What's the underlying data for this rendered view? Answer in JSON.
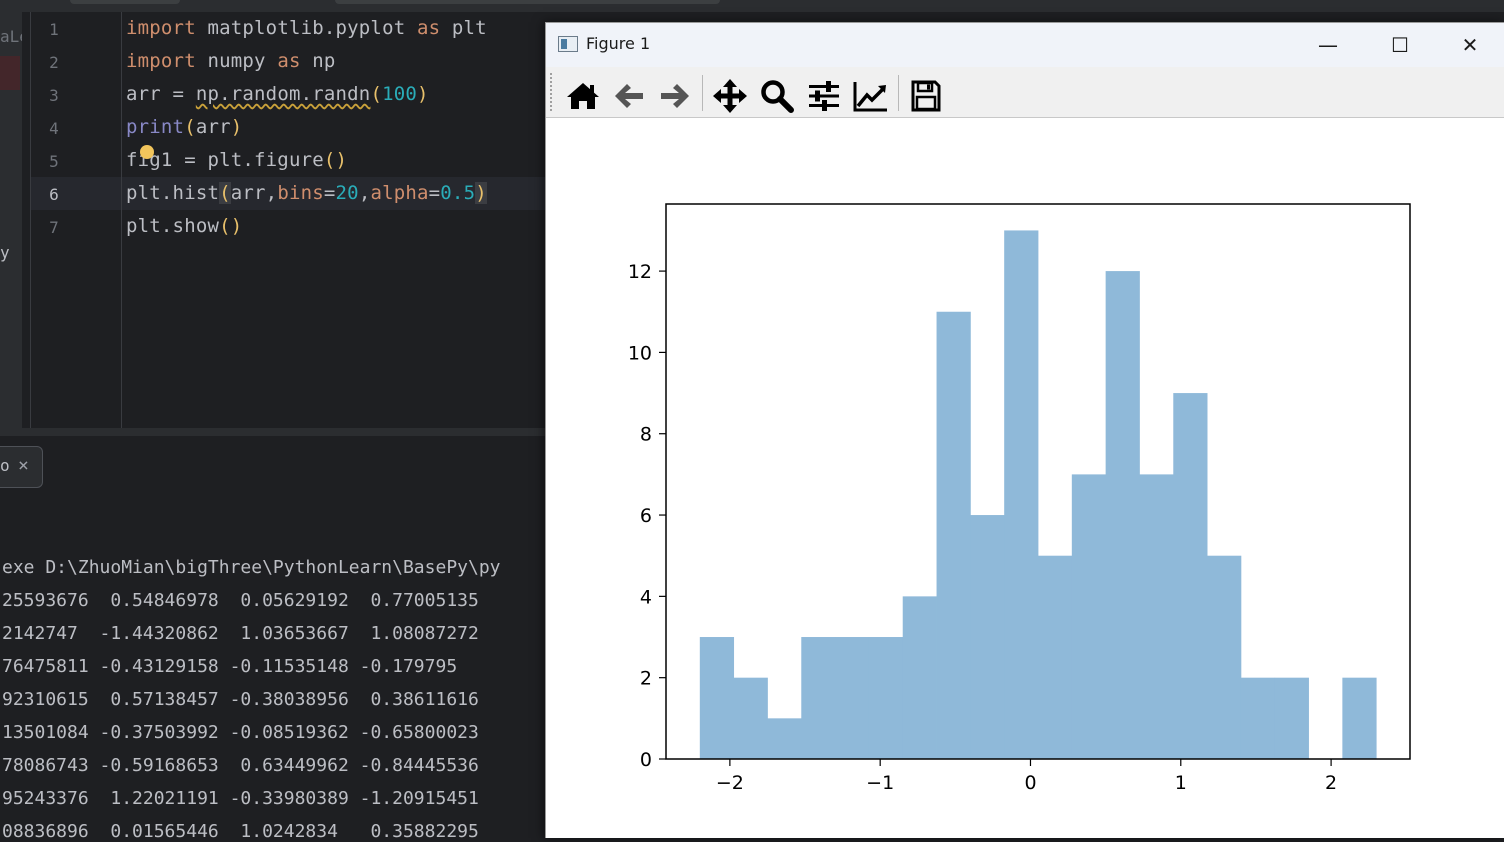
{
  "editor": {
    "left_tab_text": "aLe",
    "left_panel_char": "y",
    "line_numbers": [
      "1",
      "2",
      "3",
      "4",
      "5",
      "6",
      "7"
    ],
    "active_line": "6",
    "code": {
      "l1a": "import",
      "l1b": " matplotlib.pyplot ",
      "l1c": "as",
      "l1d": " plt",
      "l2a": "import",
      "l2b": " numpy ",
      "l2c": "as",
      "l2d": " np",
      "l3a": "arr = ",
      "l3b": "np.random.randn",
      "l3c": "(",
      "l3d": "100",
      "l3e": ")",
      "l4a": "print",
      "l4b": "(",
      "l4c": "arr",
      "l4d": ")",
      "l5a": "fig1 = plt.figure",
      "l5b": "()",
      "l6a": "plt.hist",
      "l6b": "(",
      "l6c": "arr,",
      "l6d": "bins",
      "l6e": "=",
      "l6f": "20",
      "l6g": ",",
      "l6h": "alpha",
      "l6i": "=",
      "l6j": "0.5",
      "l6k": ")",
      "l7a": "plt.show",
      "l7b": "()"
    }
  },
  "run_panel": {
    "tab_label": "o",
    "close_glyph": "×"
  },
  "console": {
    "lines": [
      "exe D:\\ZhuoMian\\bigThree\\PythonLearn\\BasePy\\py",
      "25593676  0.54846978  0.05629192  0.77005135",
      "2142747  -1.44320862  1.03653667  1.08087272",
      "76475811 -0.43129158 -0.11535148 -0.179795",
      "92310615  0.57138457 -0.38038956  0.38611616",
      "13501084 -0.37503992 -0.08519362 -0.65800023",
      "78086743 -0.59168653  0.63449962 -0.84445536",
      "95243376  1.22021191 -0.33980389 -1.20915451",
      "08836896  0.01565446  1.0242834   0.35882295"
    ]
  },
  "figure_window": {
    "title": "Figure 1",
    "minimize": "—",
    "maximize": "☐",
    "close": "✕",
    "bar_color": "#8fb9d9"
  },
  "chart_data": {
    "type": "bar",
    "title": "",
    "xlabel": "",
    "ylabel": "",
    "bin_edges": [
      -2.2,
      -1.975,
      -1.75,
      -1.525,
      -1.3,
      -1.075,
      -0.85,
      -0.625,
      -0.4,
      -0.175,
      0.05,
      0.275,
      0.5,
      0.725,
      0.95,
      1.175,
      1.4,
      1.625,
      1.85,
      2.075,
      2.3
    ],
    "values": [
      3,
      2,
      1,
      3,
      3,
      3,
      4,
      11,
      6,
      13,
      5,
      7,
      12,
      7,
      9,
      5,
      2,
      2,
      0,
      2
    ],
    "xlim": [
      -2.425,
      2.525
    ],
    "ylim": [
      0,
      13.65
    ],
    "xticks": [
      -2,
      -1,
      0,
      1,
      2
    ],
    "xtick_labels": [
      "−2",
      "−1",
      "0",
      "1",
      "2"
    ],
    "yticks": [
      0,
      2,
      4,
      6,
      8,
      10,
      12
    ],
    "ytick_labels": [
      "0",
      "2",
      "4",
      "6",
      "8",
      "10",
      "12"
    ],
    "grid": false,
    "legend": "none"
  }
}
